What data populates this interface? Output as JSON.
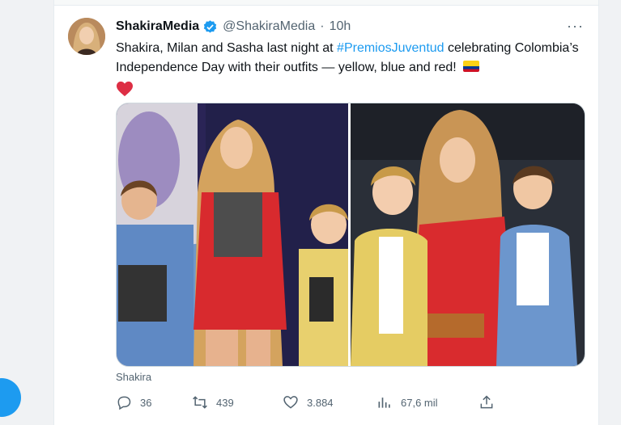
{
  "tweet": {
    "display_name": "ShakiraMedia",
    "handle": "@ShakiraMedia",
    "separator": "·",
    "time": "10h",
    "more_label": "···",
    "text_before": "Shakira, Milan and Sasha last night at ",
    "hashtag": "#PremiosJuventud",
    "text_after": " celebrating Colombia’s Independence Day with their outfits — yellow, blue and red!",
    "emoji": [
      "flag-colombia-icon",
      "red-heart-icon"
    ],
    "media_source": "Shakira",
    "stats": {
      "replies": "36",
      "retweets": "439",
      "likes": "3.884",
      "views": "67,6 mil"
    }
  },
  "colors": {
    "accent": "#1d9bf0",
    "text": "#0f1419",
    "muted": "#536471",
    "heart": "#f91880"
  }
}
